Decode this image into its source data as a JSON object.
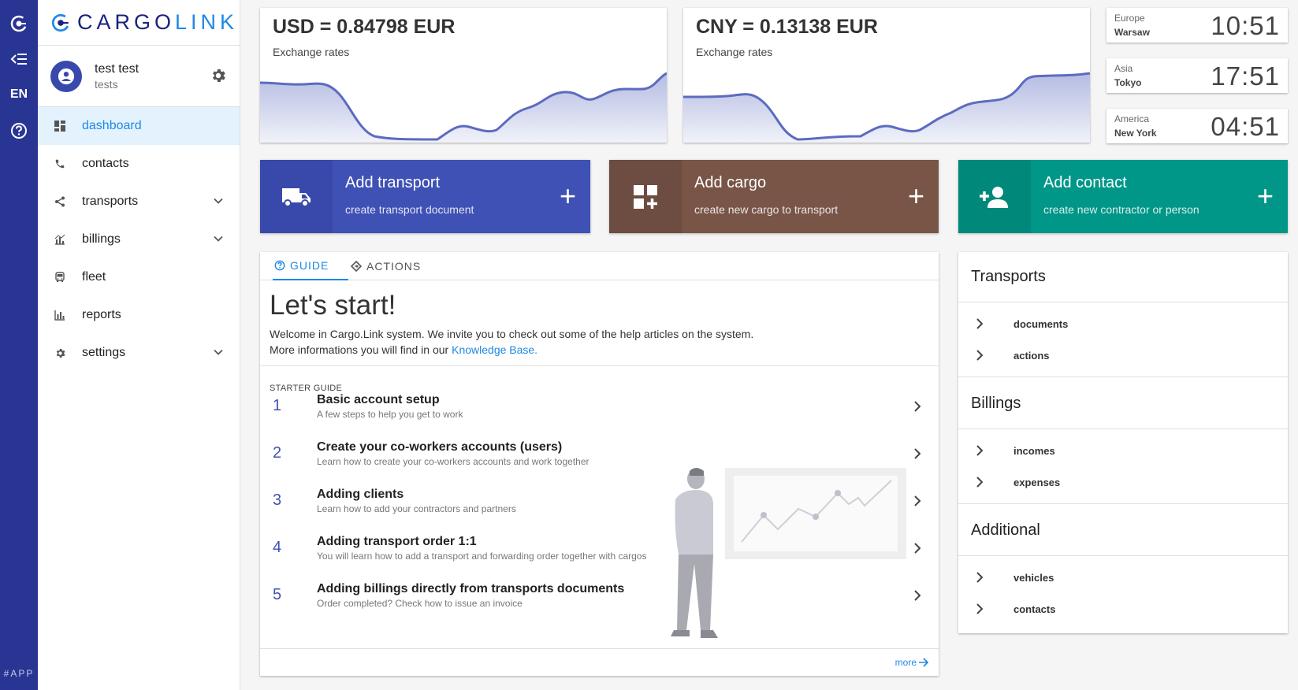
{
  "rail": {
    "lang": "EN",
    "footer": "#APP"
  },
  "brand": {
    "part1": "CARGO",
    "part2": "LINK"
  },
  "user": {
    "name": "test test",
    "sub": "tests"
  },
  "nav": [
    {
      "label": "dashboard",
      "icon": "dashboard-icon",
      "active": true
    },
    {
      "label": "contacts",
      "icon": "phone-icon"
    },
    {
      "label": "transports",
      "icon": "share-icon",
      "expandable": true
    },
    {
      "label": "billings",
      "icon": "billing-chart-icon",
      "expandable": true
    },
    {
      "label": "fleet",
      "icon": "bus-icon"
    },
    {
      "label": "reports",
      "icon": "bar-chart-icon"
    },
    {
      "label": "settings",
      "icon": "gear-icon",
      "expandable": true
    }
  ],
  "rates": [
    {
      "title": "USD = 0.84798 EUR",
      "sub": "Exchange rates"
    },
    {
      "title": "CNY = 0.13138 EUR",
      "sub": "Exchange rates"
    }
  ],
  "clocks": [
    {
      "region": "Europe",
      "city": "Warsaw",
      "time": "10:51"
    },
    {
      "region": "Asia",
      "city": "Tokyo",
      "time": "17:51"
    },
    {
      "region": "America",
      "city": "New York",
      "time": "04:51"
    }
  ],
  "actions": [
    {
      "title": "Add transport",
      "sub": "create transport document",
      "color": "#3f51b5",
      "dark": "#3949ab",
      "icon": "truck-icon"
    },
    {
      "title": "Add cargo",
      "sub": "create new cargo to transport",
      "color": "#795548",
      "dark": "#6d4c41",
      "icon": "add-cargo-icon"
    },
    {
      "title": "Add contact",
      "sub": "create new contractor or person",
      "color": "#009688",
      "dark": "#00897b",
      "icon": "add-person-icon"
    }
  ],
  "guide": {
    "tab_guide": "GUIDE",
    "tab_actions": "ACTIONS",
    "heading": "Let's start!",
    "intro_line1": "Welcome in Cargo.Link system. We invite you to check out some of the help articles on the system.",
    "intro_line2_prefix": "More informations you will find in our ",
    "intro_link": "Knowledge Base.",
    "starter_label": "STARTER GUIDE",
    "steps": [
      {
        "num": "1",
        "title": "Basic account setup",
        "sub": "A few steps to help you get to work"
      },
      {
        "num": "2",
        "title": "Create your co-workers accounts (users)",
        "sub": "Learn how to create your co-workers accounts and work together"
      },
      {
        "num": "3",
        "title": "Adding clients",
        "sub": "Learn how to add your contractors and partners"
      },
      {
        "num": "4",
        "title": "Adding transport order 1:1",
        "sub": "You will learn how to add a transport and forwarding order together with cargos"
      },
      {
        "num": "5",
        "title": "Adding billings directly from transports documents",
        "sub": "Order completed? Check how to issue an invoice"
      }
    ],
    "more": "more"
  },
  "quicklinks": {
    "sections": [
      {
        "title": "Transports",
        "links": [
          "documents",
          "actions"
        ]
      },
      {
        "title": "Billings",
        "links": [
          "incomes",
          "expenses"
        ]
      },
      {
        "title": "Additional",
        "links": [
          "vehicles",
          "contacts"
        ]
      }
    ]
  },
  "colors": {
    "rail": "#283593",
    "accent": "#1e88e5",
    "chart_line": "#5c6bc0"
  }
}
